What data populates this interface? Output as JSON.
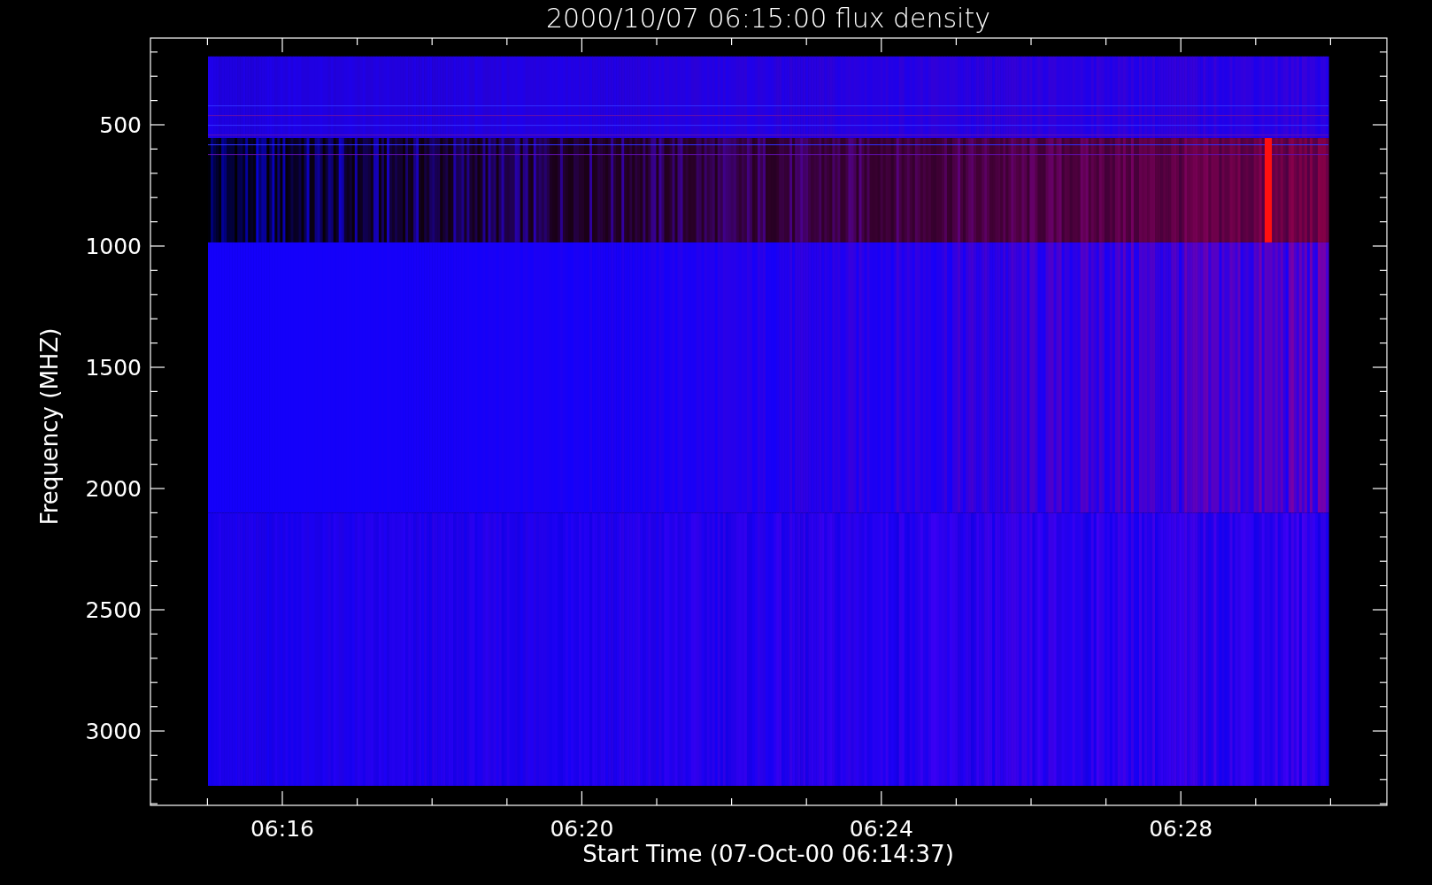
{
  "title": "2000/10/07 06:15:00 flux density",
  "x_axis": {
    "label": "Start Time (07-Oct-00 06:14:37)",
    "ticks": [
      "06:16",
      "06:20",
      "06:24",
      "06:28"
    ]
  },
  "y_axis": {
    "label": "Frequency (MHZ)",
    "ticks": [
      "500",
      "1000",
      "1500",
      "2000",
      "2500",
      "3000"
    ]
  }
}
